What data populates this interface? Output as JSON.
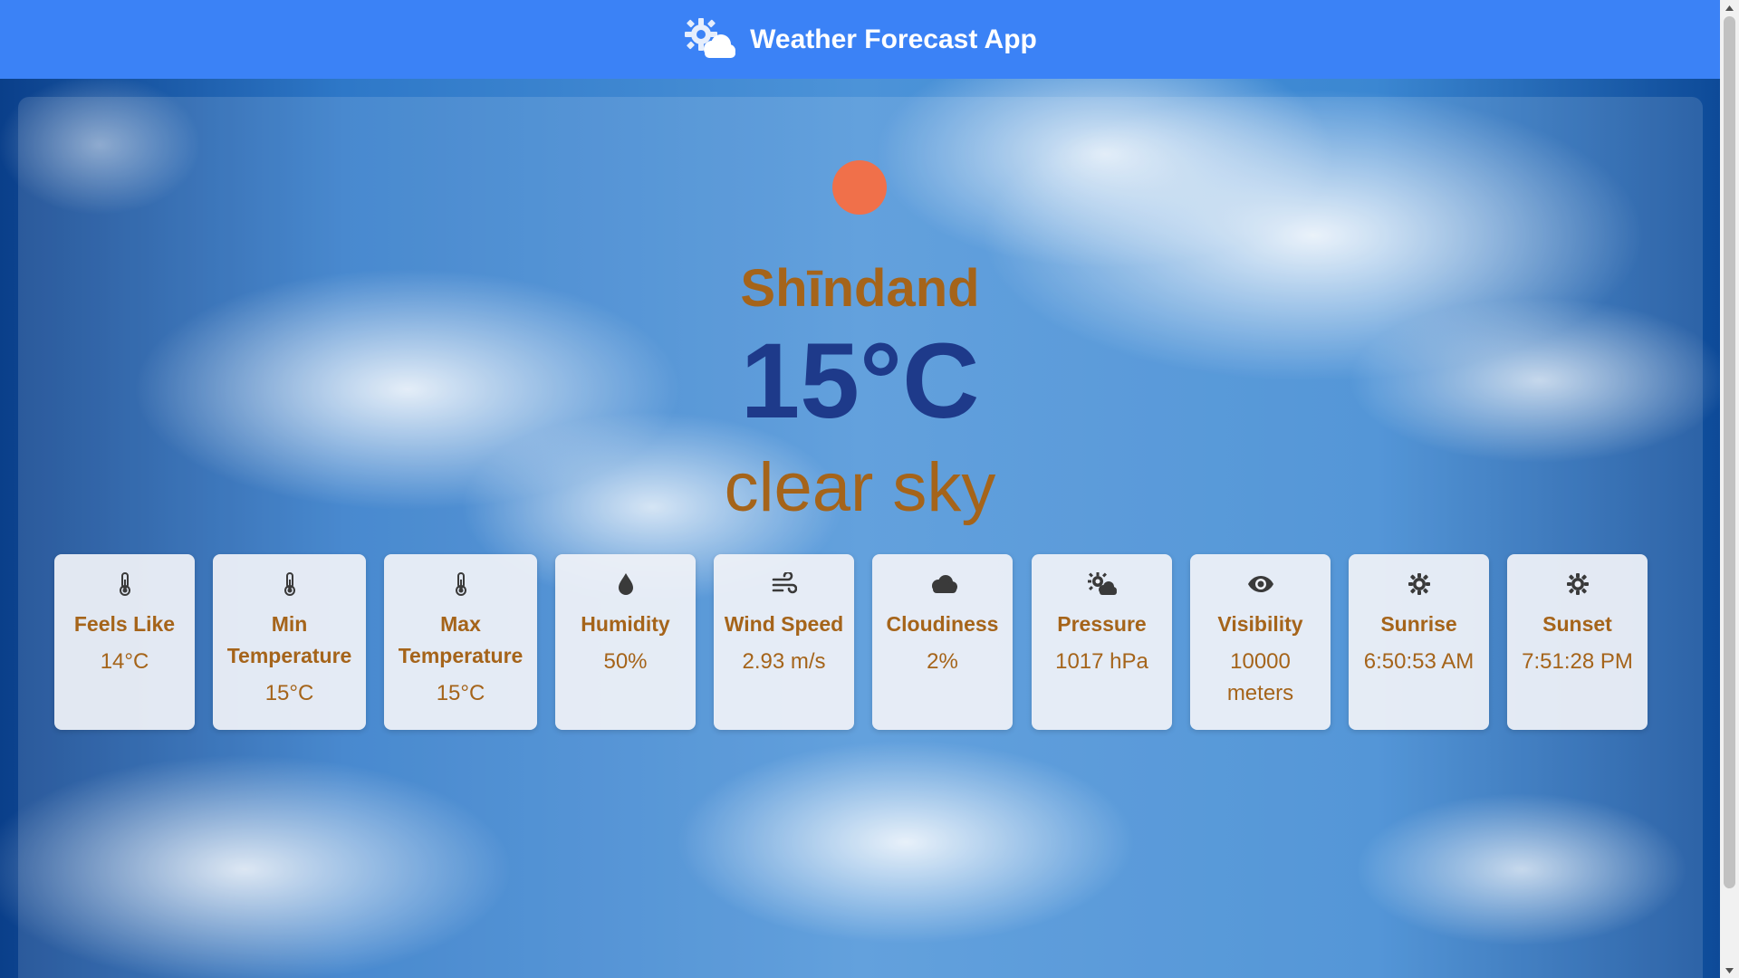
{
  "header": {
    "title": "Weather Forecast App",
    "logo_icon": "sun-cloud-icon"
  },
  "weather": {
    "icon": "sun-icon",
    "icon_color": "#f0704a",
    "city": "Shīndand",
    "temperature": "15°C",
    "description": "clear sky"
  },
  "metrics": [
    {
      "icon": "thermometer-icon",
      "label": "Feels Like",
      "value": "14°C"
    },
    {
      "icon": "thermometer-icon",
      "label": "Min Temperature",
      "value": "15°C"
    },
    {
      "icon": "thermometer-icon",
      "label": "Max Temperature",
      "value": "15°C"
    },
    {
      "icon": "droplet-icon",
      "label": "Humidity",
      "value": "50%"
    },
    {
      "icon": "wind-icon",
      "label": "Wind Speed",
      "value": "2.93 m/s"
    },
    {
      "icon": "cloud-icon",
      "label": "Cloudiness",
      "value": "2%"
    },
    {
      "icon": "sun-cloud-icon",
      "label": "Pressure",
      "value": "1017 hPa"
    },
    {
      "icon": "eye-icon",
      "label": "Visibility",
      "value": "10000 meters"
    },
    {
      "icon": "gear-sun-icon",
      "label": "Sunrise",
      "value": "6:50:53 AM"
    },
    {
      "icon": "gear-sun-icon",
      "label": "Sunset",
      "value": "7:51:28 PM"
    }
  ],
  "colors": {
    "header_bg": "#3b82f6",
    "accent_text": "#a5641a",
    "temperature_text": "#1e3a8a",
    "card_bg": "#f0f2f7"
  }
}
